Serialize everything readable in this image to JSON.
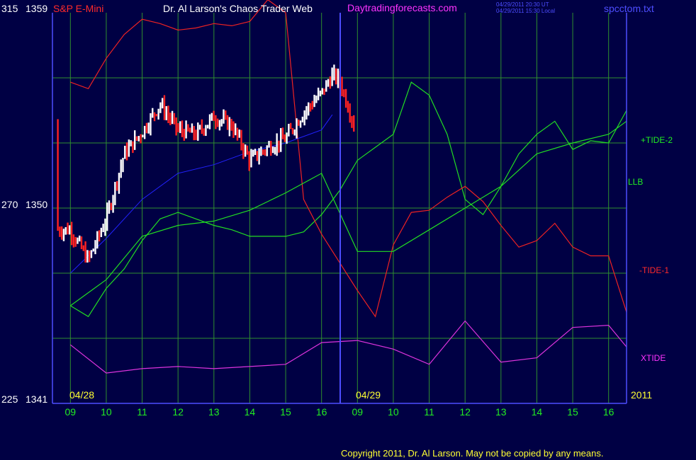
{
  "header": {
    "y_left_top": "315",
    "y_price_top": "1359",
    "symbol": "S&P E-Mini",
    "title": "Dr. Al Larson's Chaos Trader Web",
    "website": "Daytradingforecasts.com",
    "timestamp_ut": "04/29/2011 20:30 UT",
    "timestamp_local": "04/29/2011 15:30 Local",
    "filename": "spcctom.txt"
  },
  "axis_labels": {
    "y_left_mid": "270",
    "y_price_mid": "1350",
    "y_left_bottom": "225",
    "y_price_bottom": "1341",
    "date_left": "04/28",
    "date_right": "04/29",
    "year": "2011"
  },
  "legend": {
    "tide2": "+TIDE-2",
    "llb": "LLB",
    "tide1": "-TIDE-1",
    "xtide": "XTIDE"
  },
  "footer": {
    "copyright": "Copyright 2011, Dr. Al Larson. May not be copied by any means."
  },
  "colors": {
    "background": "#000044",
    "grid": "#2f8f2f",
    "divider": "#4d4dff",
    "price_up": "#ffffff",
    "price_down": "#ff2222",
    "tide2": "#22dd22",
    "tide1": "#ee2222",
    "xtide": "#dd33dd",
    "avg": "#2222ff",
    "hour_labels": "#22ee22"
  },
  "chart_data": {
    "type": "line",
    "title": "S&P E-Mini",
    "x_tick_labels": [
      "09",
      "10",
      "11",
      "12",
      "13",
      "14",
      "15",
      "16",
      "09",
      "10",
      "11",
      "12",
      "13",
      "14",
      "15",
      "16"
    ],
    "ylim": [
      1341,
      1359
    ],
    "y_ticks": [
      1341,
      1350,
      1359
    ],
    "y_ticks_left": [
      225,
      270,
      315
    ],
    "series": [
      {
        "name": "+TIDE-2",
        "x": [
          0,
          0.5,
          1,
          1.5,
          2,
          2.5,
          3,
          3.5,
          4,
          4.5,
          5,
          5.5,
          6,
          6.5,
          7,
          7.5,
          8,
          8.5,
          9,
          9.5,
          10,
          10.5,
          11,
          11.5,
          12,
          12.5,
          13,
          13.5,
          14,
          14.5,
          15,
          15.5
        ],
        "y": [
          1345.5,
          1345,
          1346.3,
          1347.2,
          1348.5,
          1349.5,
          1349.8,
          1349.5,
          1349.2,
          1349,
          1348.7,
          1348.7,
          1348.7,
          1348.9,
          1349.7,
          1350.8,
          1352.2,
          1352.8,
          1353.4,
          1355.8,
          1355.2,
          1353.4,
          1350.4,
          1349.7,
          1351,
          1352.5,
          1353.4,
          1354,
          1352.7,
          1353.1,
          1353,
          1354.5
        ]
      },
      {
        "name": "-TIDE-1",
        "x": [
          0,
          0.5,
          1,
          1.5,
          2,
          2.5,
          3,
          3.5,
          4,
          4.5,
          5,
          5.5,
          6,
          6.5,
          7,
          7.5,
          8,
          8.5,
          9,
          9.5,
          10,
          10.5,
          11,
          11.5,
          12,
          12.5,
          13,
          13.5,
          14,
          14.5,
          15,
          15.5
        ],
        "y": [
          1355.8,
          1355.5,
          1356.9,
          1358,
          1358.7,
          1358.5,
          1358.2,
          1358.3,
          1358.5,
          1358.4,
          1358.6,
          1359.6,
          1359,
          1350.4,
          1348.8,
          1347.5,
          1346.2,
          1345,
          1348.3,
          1349.8,
          1349.9,
          1350.5,
          1351,
          1350.3,
          1349.2,
          1348.2,
          1348.5,
          1349.3,
          1348.2,
          1347.8,
          1347.8,
          1345.2
        ]
      },
      {
        "name": "XTIDE",
        "x": [
          0,
          1,
          2,
          3,
          4,
          5,
          6,
          7,
          8,
          9,
          10,
          11,
          12,
          13,
          14,
          15,
          15.5
        ],
        "y": [
          1343.7,
          1342.4,
          1342.6,
          1342.7,
          1342.6,
          1342.7,
          1342.8,
          1343.8,
          1343.9,
          1343.5,
          1342.8,
          1344.8,
          1342.9,
          1343.1,
          1344.5,
          1344.6,
          1343.6
        ]
      },
      {
        "name": "LLB",
        "x": [
          0,
          1,
          2,
          3,
          4,
          5,
          6,
          7,
          8,
          9,
          10,
          11,
          12,
          13,
          14,
          15,
          15.5
        ],
        "y": [
          1345.5,
          1346.7,
          1348.7,
          1349.2,
          1349.4,
          1349.9,
          1350.7,
          1351.6,
          1348,
          1348,
          1349,
          1350,
          1351,
          1352.5,
          1353,
          1353.4,
          1354
        ]
      }
    ],
    "legend_position": "right",
    "grid": true
  }
}
